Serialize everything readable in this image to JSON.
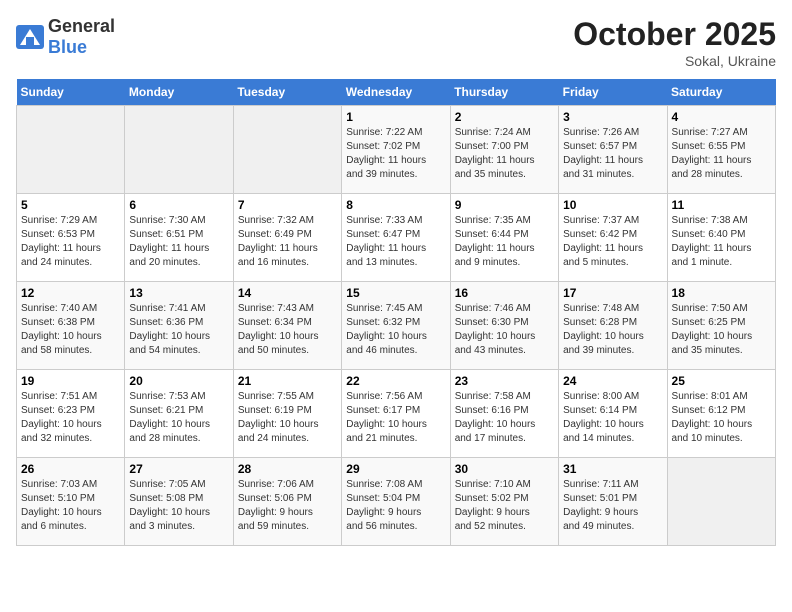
{
  "header": {
    "logo_general": "General",
    "logo_blue": "Blue",
    "month": "October 2025",
    "location": "Sokal, Ukraine"
  },
  "weekdays": [
    "Sunday",
    "Monday",
    "Tuesday",
    "Wednesday",
    "Thursday",
    "Friday",
    "Saturday"
  ],
  "weeks": [
    [
      {
        "day": "",
        "info": ""
      },
      {
        "day": "",
        "info": ""
      },
      {
        "day": "",
        "info": ""
      },
      {
        "day": "1",
        "info": "Sunrise: 7:22 AM\nSunset: 7:02 PM\nDaylight: 11 hours\nand 39 minutes."
      },
      {
        "day": "2",
        "info": "Sunrise: 7:24 AM\nSunset: 7:00 PM\nDaylight: 11 hours\nand 35 minutes."
      },
      {
        "day": "3",
        "info": "Sunrise: 7:26 AM\nSunset: 6:57 PM\nDaylight: 11 hours\nand 31 minutes."
      },
      {
        "day": "4",
        "info": "Sunrise: 7:27 AM\nSunset: 6:55 PM\nDaylight: 11 hours\nand 28 minutes."
      }
    ],
    [
      {
        "day": "5",
        "info": "Sunrise: 7:29 AM\nSunset: 6:53 PM\nDaylight: 11 hours\nand 24 minutes."
      },
      {
        "day": "6",
        "info": "Sunrise: 7:30 AM\nSunset: 6:51 PM\nDaylight: 11 hours\nand 20 minutes."
      },
      {
        "day": "7",
        "info": "Sunrise: 7:32 AM\nSunset: 6:49 PM\nDaylight: 11 hours\nand 16 minutes."
      },
      {
        "day": "8",
        "info": "Sunrise: 7:33 AM\nSunset: 6:47 PM\nDaylight: 11 hours\nand 13 minutes."
      },
      {
        "day": "9",
        "info": "Sunrise: 7:35 AM\nSunset: 6:44 PM\nDaylight: 11 hours\nand 9 minutes."
      },
      {
        "day": "10",
        "info": "Sunrise: 7:37 AM\nSunset: 6:42 PM\nDaylight: 11 hours\nand 5 minutes."
      },
      {
        "day": "11",
        "info": "Sunrise: 7:38 AM\nSunset: 6:40 PM\nDaylight: 11 hours\nand 1 minute."
      }
    ],
    [
      {
        "day": "12",
        "info": "Sunrise: 7:40 AM\nSunset: 6:38 PM\nDaylight: 10 hours\nand 58 minutes."
      },
      {
        "day": "13",
        "info": "Sunrise: 7:41 AM\nSunset: 6:36 PM\nDaylight: 10 hours\nand 54 minutes."
      },
      {
        "day": "14",
        "info": "Sunrise: 7:43 AM\nSunset: 6:34 PM\nDaylight: 10 hours\nand 50 minutes."
      },
      {
        "day": "15",
        "info": "Sunrise: 7:45 AM\nSunset: 6:32 PM\nDaylight: 10 hours\nand 46 minutes."
      },
      {
        "day": "16",
        "info": "Sunrise: 7:46 AM\nSunset: 6:30 PM\nDaylight: 10 hours\nand 43 minutes."
      },
      {
        "day": "17",
        "info": "Sunrise: 7:48 AM\nSunset: 6:28 PM\nDaylight: 10 hours\nand 39 minutes."
      },
      {
        "day": "18",
        "info": "Sunrise: 7:50 AM\nSunset: 6:25 PM\nDaylight: 10 hours\nand 35 minutes."
      }
    ],
    [
      {
        "day": "19",
        "info": "Sunrise: 7:51 AM\nSunset: 6:23 PM\nDaylight: 10 hours\nand 32 minutes."
      },
      {
        "day": "20",
        "info": "Sunrise: 7:53 AM\nSunset: 6:21 PM\nDaylight: 10 hours\nand 28 minutes."
      },
      {
        "day": "21",
        "info": "Sunrise: 7:55 AM\nSunset: 6:19 PM\nDaylight: 10 hours\nand 24 minutes."
      },
      {
        "day": "22",
        "info": "Sunrise: 7:56 AM\nSunset: 6:17 PM\nDaylight: 10 hours\nand 21 minutes."
      },
      {
        "day": "23",
        "info": "Sunrise: 7:58 AM\nSunset: 6:16 PM\nDaylight: 10 hours\nand 17 minutes."
      },
      {
        "day": "24",
        "info": "Sunrise: 8:00 AM\nSunset: 6:14 PM\nDaylight: 10 hours\nand 14 minutes."
      },
      {
        "day": "25",
        "info": "Sunrise: 8:01 AM\nSunset: 6:12 PM\nDaylight: 10 hours\nand 10 minutes."
      }
    ],
    [
      {
        "day": "26",
        "info": "Sunrise: 7:03 AM\nSunset: 5:10 PM\nDaylight: 10 hours\nand 6 minutes."
      },
      {
        "day": "27",
        "info": "Sunrise: 7:05 AM\nSunset: 5:08 PM\nDaylight: 10 hours\nand 3 minutes."
      },
      {
        "day": "28",
        "info": "Sunrise: 7:06 AM\nSunset: 5:06 PM\nDaylight: 9 hours\nand 59 minutes."
      },
      {
        "day": "29",
        "info": "Sunrise: 7:08 AM\nSunset: 5:04 PM\nDaylight: 9 hours\nand 56 minutes."
      },
      {
        "day": "30",
        "info": "Sunrise: 7:10 AM\nSunset: 5:02 PM\nDaylight: 9 hours\nand 52 minutes."
      },
      {
        "day": "31",
        "info": "Sunrise: 7:11 AM\nSunset: 5:01 PM\nDaylight: 9 hours\nand 49 minutes."
      },
      {
        "day": "",
        "info": ""
      }
    ]
  ]
}
